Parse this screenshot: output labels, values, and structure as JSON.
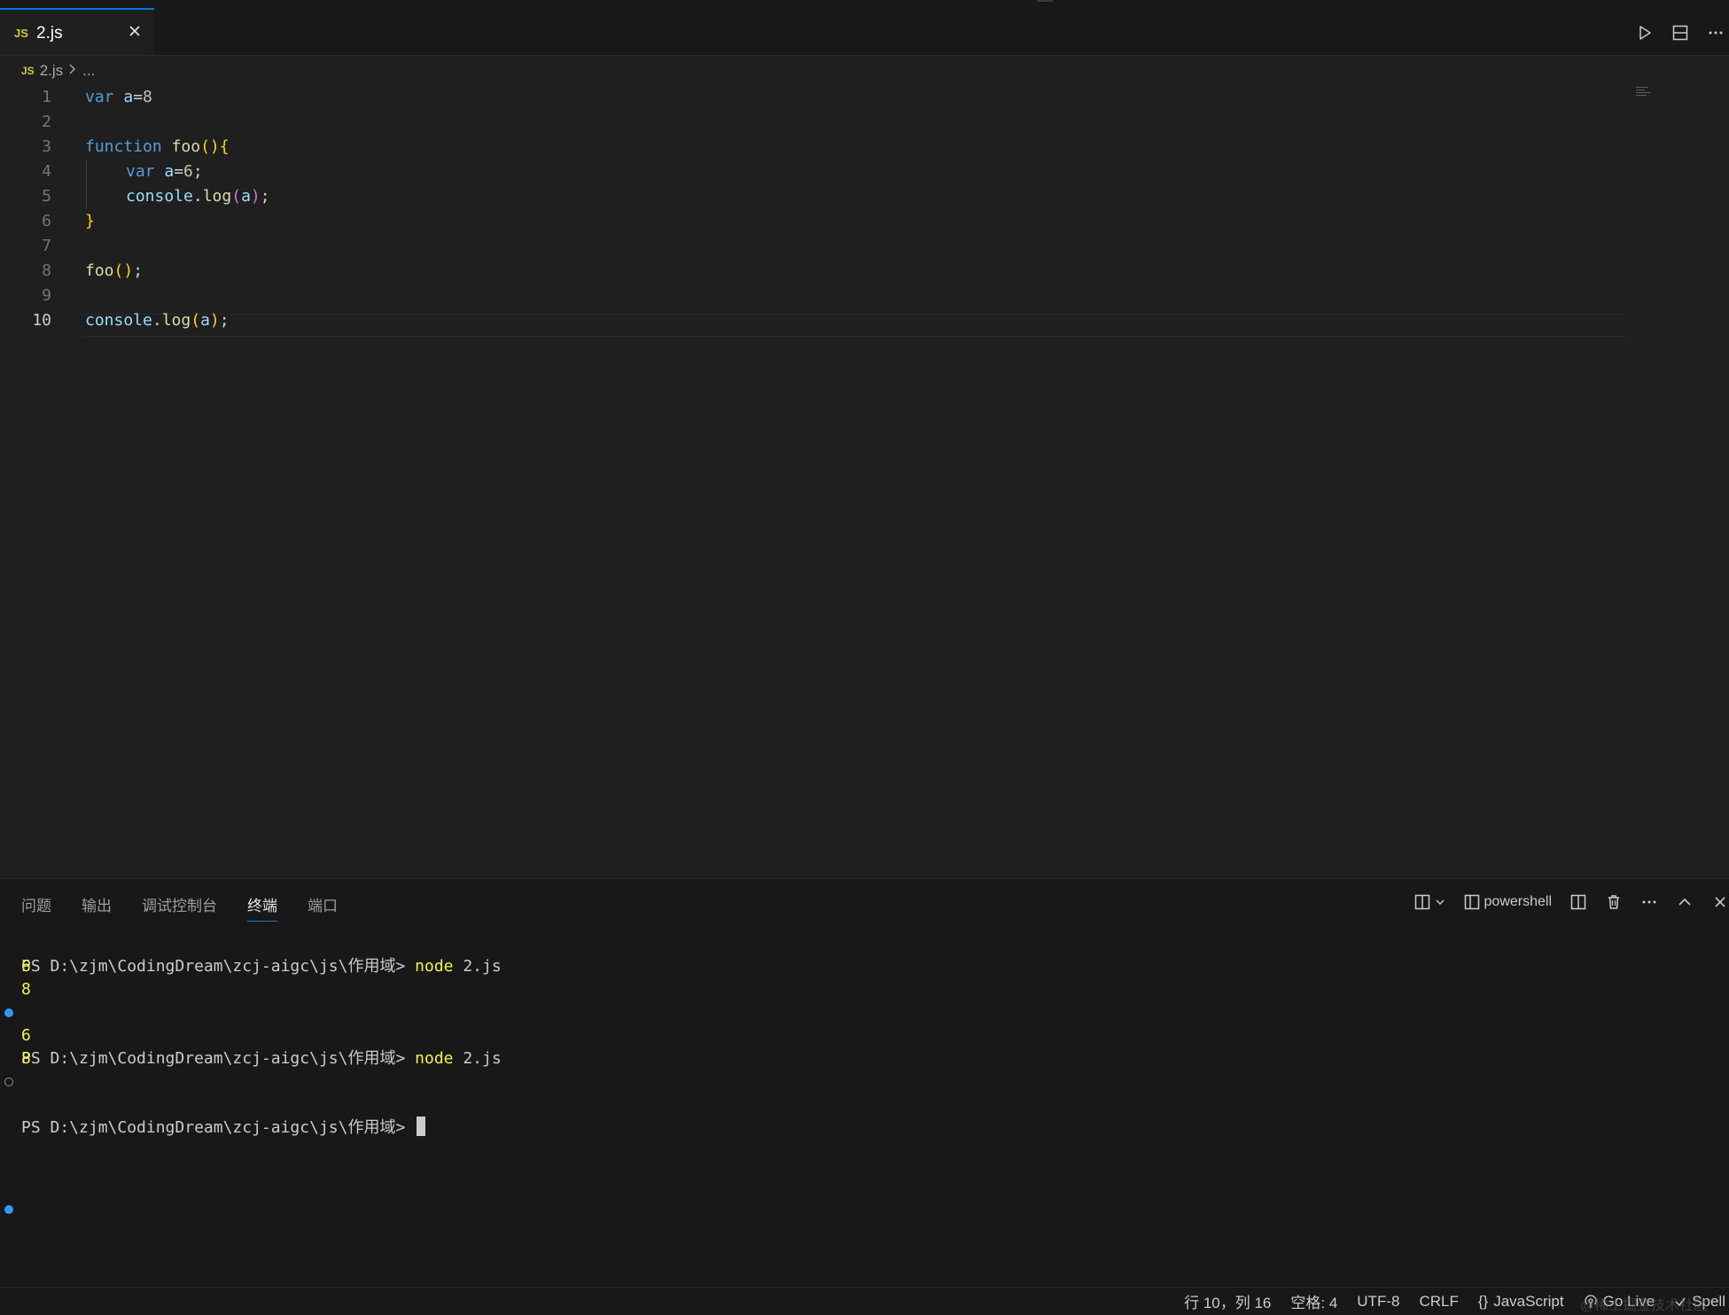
{
  "editor_tab": {
    "badge": "JS",
    "filename": "2.js"
  },
  "tab_actions": {
    "run_icon": "play-icon",
    "split_icon": "split-editor-icon",
    "more_icon": "more-icon"
  },
  "breadcrumb": {
    "badge": "JS",
    "file": "2.js",
    "separator": ">",
    "rest": "..."
  },
  "code": {
    "active_line": 10,
    "lines": [
      {
        "n": "1"
      },
      {
        "n": "2"
      },
      {
        "n": "3"
      },
      {
        "n": "4"
      },
      {
        "n": "5"
      },
      {
        "n": "6"
      },
      {
        "n": "7"
      },
      {
        "n": "8"
      },
      {
        "n": "9"
      },
      {
        "n": "10"
      }
    ],
    "tokens": {
      "l1": [
        "var",
        " ",
        "a",
        "=",
        "8"
      ],
      "l3": [
        "function",
        " ",
        "foo",
        "(",
        ")",
        "{"
      ],
      "l4": [
        "var",
        " ",
        "a",
        "=",
        "6",
        ";"
      ],
      "l5": [
        "console",
        ".",
        "log",
        "(",
        "a",
        ")",
        ";"
      ],
      "l6": [
        "}"
      ],
      "l8": [
        "foo",
        "(",
        ")",
        ";"
      ],
      "l10": [
        "console",
        ".",
        "log",
        "(",
        "a",
        ")",
        ";"
      ]
    }
  },
  "panel": {
    "tabs": [
      "问题",
      "输出",
      "调试控制台",
      "终端",
      "端口"
    ],
    "active_tab": "终端",
    "shell_label": "powershell"
  },
  "terminal": {
    "prompt": "PS D:\\zjm\\CodingDream\\zcj-aigc\\js\\作用域> ",
    "cmd1_bin": "node",
    "cmd1_arg": " 2.js",
    "out1": [
      "6",
      "8"
    ],
    "cmd2_bin": "node",
    "cmd2_arg": " 2.js",
    "out2": [
      "6",
      "8"
    ]
  },
  "status": {
    "position": "行 10，列 16",
    "spaces": "空格: 4",
    "encoding": "UTF-8",
    "eol": "CRLF",
    "language_braces": "{}",
    "language": "JavaScript",
    "golive": "Go Live",
    "spell": "Spell",
    "watermark": "@稀土掘金技术社区"
  },
  "colors": {
    "accent": "#0078d4",
    "keyword": "#569cd6",
    "variable": "#9cdcfe",
    "function": "#dcdcaa",
    "number": "#b5cea8",
    "terminal_yellow": "#f5f543"
  }
}
